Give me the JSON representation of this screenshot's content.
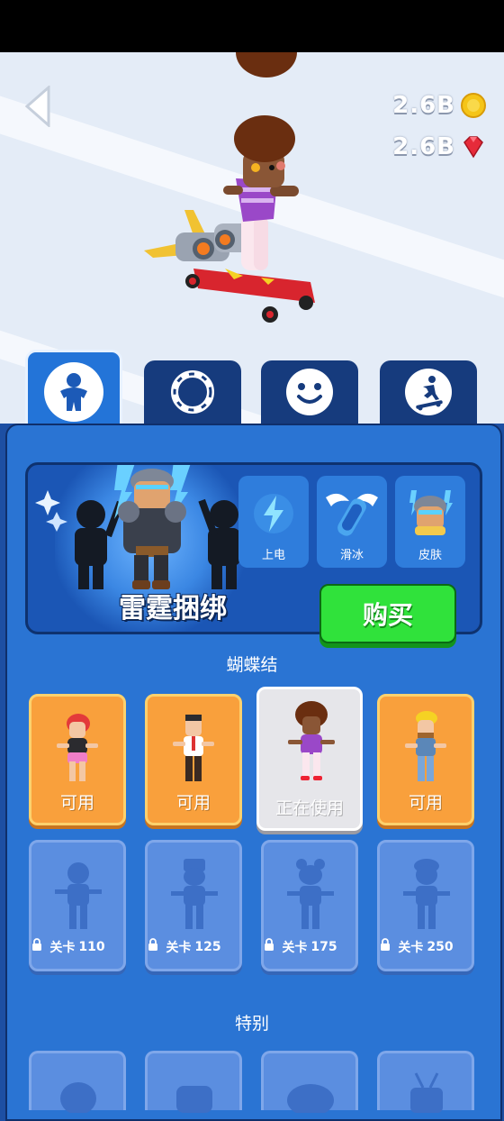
{
  "currency": {
    "coins": "2.6B",
    "gems": "2.6B"
  },
  "tabs": [
    {
      "icon": "character-icon",
      "active": true
    },
    {
      "icon": "ring-icon",
      "active": false
    },
    {
      "icon": "face-icon",
      "active": false
    },
    {
      "icon": "skateboarder-icon",
      "active": false
    }
  ],
  "featured": {
    "title": "雷霆捆绑",
    "perks": [
      {
        "label": "上电",
        "icon": "lightning-icon"
      },
      {
        "label": "滑冰",
        "icon": "winged-board-icon"
      },
      {
        "label": "皮肤",
        "icon": "helmet-skin-icon"
      }
    ],
    "buy_label": "购买"
  },
  "sections": {
    "bowtie_title": "蝴蝶结",
    "special_title": "特别"
  },
  "characters": [
    {
      "status": "可用",
      "state": "available"
    },
    {
      "status": "可用",
      "state": "available"
    },
    {
      "status": "正在使用",
      "state": "in-use"
    },
    {
      "status": "可用",
      "state": "available"
    }
  ],
  "locked": [
    {
      "text": "关卡",
      "level": "110"
    },
    {
      "text": "关卡",
      "level": "125"
    },
    {
      "text": "关卡",
      "level": "175"
    },
    {
      "text": "关卡",
      "level": "250"
    }
  ],
  "colors": {
    "panel": "#2a74d3",
    "buy": "#30e23b",
    "available": "#f9a03c",
    "locked": "#5b8ee0"
  }
}
